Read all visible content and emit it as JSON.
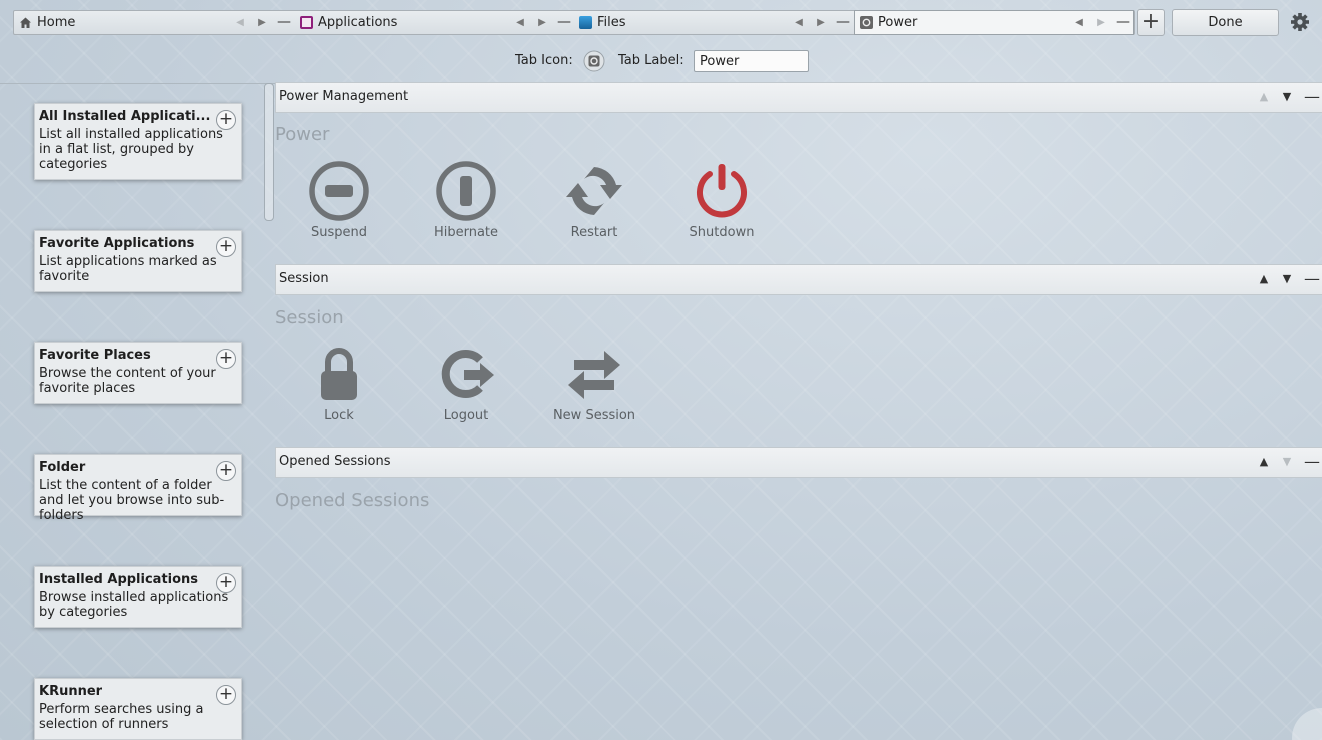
{
  "tabs": [
    {
      "label": "Home",
      "icon": "home-icon"
    },
    {
      "label": "Applications",
      "icon": "applications-icon",
      "color": "#8e1f7a"
    },
    {
      "label": "Files",
      "icon": "files-icon",
      "color": "#1c7fc2"
    },
    {
      "label": "Power",
      "icon": "power-tab-icon",
      "active": true
    }
  ],
  "toolbar": {
    "add_label": "+",
    "done_label": "Done"
  },
  "tab_props": {
    "icon_label": "Tab Icon:",
    "label_label": "Tab Label:",
    "label_value": "Power"
  },
  "widgets": [
    {
      "title": "All Installed Applicati...",
      "desc": "List all installed applications in a flat list, grouped by categories"
    },
    {
      "title": "Favorite Applications",
      "desc": "List applications marked as favorite"
    },
    {
      "title": "Favorite Places",
      "desc": "Browse the content of your favorite places"
    },
    {
      "title": "Folder",
      "desc": "List the content of a folder and let you browse into sub-folders"
    },
    {
      "title": "Installed Applications",
      "desc": "Browse installed applications by categories"
    },
    {
      "title": "KRunner",
      "desc": "Perform searches using a selection of runners"
    }
  ],
  "sections": [
    {
      "header": "Power Management",
      "heading": "Power",
      "actions": [
        {
          "label": "Suspend",
          "icon": "suspend-icon"
        },
        {
          "label": "Hibernate",
          "icon": "hibernate-icon"
        },
        {
          "label": "Restart",
          "icon": "restart-icon"
        },
        {
          "label": "Shutdown",
          "icon": "shutdown-icon",
          "color": "#c1393d"
        }
      ]
    },
    {
      "header": "Session",
      "heading": "Session",
      "actions": [
        {
          "label": "Lock",
          "icon": "lock-icon"
        },
        {
          "label": "Logout",
          "icon": "logout-icon"
        },
        {
          "label": "New Session",
          "icon": "new-session-icon"
        }
      ]
    },
    {
      "header": "Opened Sessions",
      "heading": "Opened Sessions",
      "actions": []
    }
  ],
  "colors": {
    "icon_gray": "#6f7376",
    "shutdown_red": "#c1393d"
  }
}
